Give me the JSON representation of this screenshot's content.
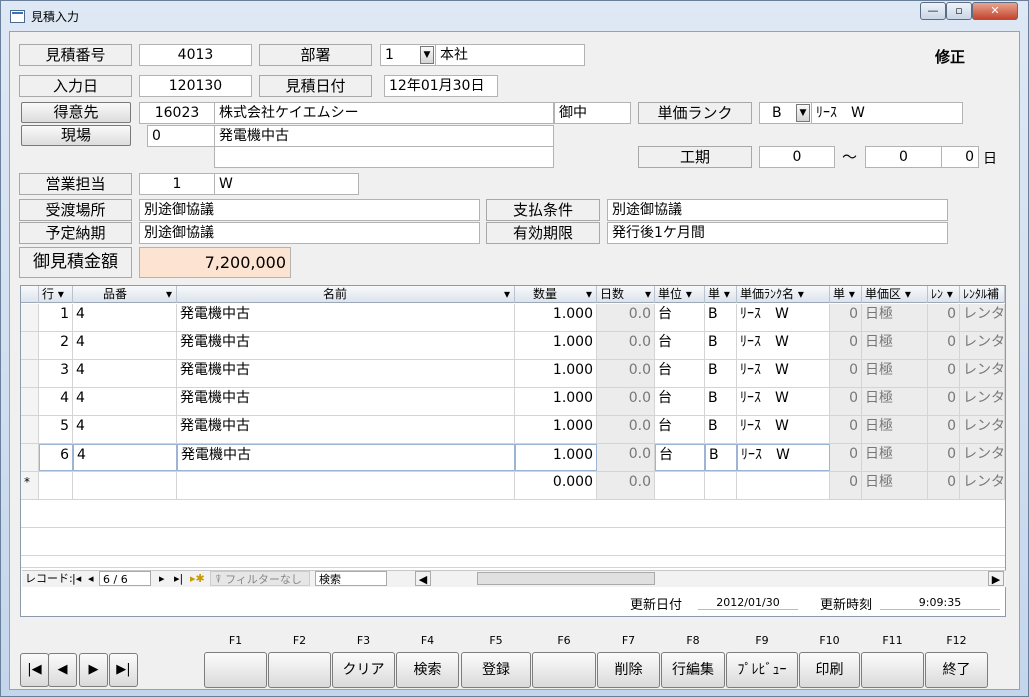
{
  "window": {
    "title": "見積入力",
    "min": "—",
    "max": "▫",
    "close": "✕"
  },
  "header": {
    "estimate_no_label": "見積番号",
    "estimate_no": "4013",
    "dept_label": "部署",
    "dept_code": "1",
    "dept_name": "本社",
    "mode": "修正",
    "input_date_label": "入力日",
    "input_date": "120130",
    "estimate_date_label": "見積日付",
    "estimate_date": "12年01月30日",
    "customer_btn": "得意先",
    "customer_code": "16023",
    "customer_name": "株式会社ケイエムシー",
    "honorific": "御中",
    "site_btn": "現場",
    "site_code": "0",
    "site_name": "発電機中古",
    "site_extra": "",
    "price_rank_label": "単価ランク",
    "price_rank": "B",
    "price_rank_name": "ﾘｰｽ　W",
    "period_label": "工期",
    "period_from": "0",
    "period_sep": "～",
    "period_to": "0",
    "period_days": "0",
    "period_unit": "日",
    "sales_label": "営業担当",
    "sales_code": "1",
    "sales_name": "W",
    "delivery_place_label": "受渡場所",
    "delivery_place": "別途御協議",
    "payment_label": "支払条件",
    "payment": "別途御協議",
    "due_label": "予定納期",
    "due": "別途御協議",
    "valid_label": "有効期限",
    "valid": "発行後1ケ月間",
    "amount_label": "御見積金額",
    "amount": "7,200,000"
  },
  "grid": {
    "columns": [
      "行",
      "品番",
      "名前",
      "数量",
      "日数",
      "単位",
      "単",
      "単価ﾗﾝｸ名",
      "単",
      "単価区",
      "ﾚﾝ",
      "ﾚﾝﾀﾙ補"
    ],
    "rows": [
      {
        "line": "1",
        "code": "4",
        "name": "発電機中古",
        "qty": "1.000",
        "days": "0.0",
        "unit": "台",
        "rank": "B",
        "rank_name": "ﾘｰｽ　W",
        "u": "0",
        "price_div": "日極",
        "r": "0",
        "rental": "レンタ"
      },
      {
        "line": "2",
        "code": "4",
        "name": "発電機中古",
        "qty": "1.000",
        "days": "0.0",
        "unit": "台",
        "rank": "B",
        "rank_name": "ﾘｰｽ　W",
        "u": "0",
        "price_div": "日極",
        "r": "0",
        "rental": "レンタ"
      },
      {
        "line": "3",
        "code": "4",
        "name": "発電機中古",
        "qty": "1.000",
        "days": "0.0",
        "unit": "台",
        "rank": "B",
        "rank_name": "ﾘｰｽ　W",
        "u": "0",
        "price_div": "日極",
        "r": "0",
        "rental": "レンタ"
      },
      {
        "line": "4",
        "code": "4",
        "name": "発電機中古",
        "qty": "1.000",
        "days": "0.0",
        "unit": "台",
        "rank": "B",
        "rank_name": "ﾘｰｽ　W",
        "u": "0",
        "price_div": "日極",
        "r": "0",
        "rental": "レンタ"
      },
      {
        "line": "5",
        "code": "4",
        "name": "発電機中古",
        "qty": "1.000",
        "days": "0.0",
        "unit": "台",
        "rank": "B",
        "rank_name": "ﾘｰｽ　W",
        "u": "0",
        "price_div": "日極",
        "r": "0",
        "rental": "レンタ"
      },
      {
        "line": "6",
        "code": "4",
        "name": "発電機中古",
        "qty": "1.000",
        "days": "0.0",
        "unit": "台",
        "rank": "B",
        "rank_name": "ﾘｰｽ　W",
        "u": "0",
        "price_div": "日極",
        "r": "0",
        "rental": "レンタ"
      }
    ],
    "new_row": {
      "marker": "*",
      "qty": "0.000",
      "days": "0.0",
      "u": "0",
      "price_div": "日極",
      "r": "0",
      "rental": "レンタ"
    },
    "nav": {
      "record_label": "レコード:",
      "position": "6 / 6",
      "filter": "フィルターなし",
      "search": "検索"
    }
  },
  "footer": {
    "update_date_label": "更新日付",
    "update_date": "2012/01/30",
    "update_time_label": "更新時刻",
    "update_time": "9:09:35"
  },
  "fkeys": [
    {
      "key": "F1",
      "label": ""
    },
    {
      "key": "F2",
      "label": ""
    },
    {
      "key": "F3",
      "label": "クリア"
    },
    {
      "key": "F4",
      "label": "検索"
    },
    {
      "key": "F5",
      "label": "登録"
    },
    {
      "key": "F6",
      "label": ""
    },
    {
      "key": "F7",
      "label": "削除"
    },
    {
      "key": "F8",
      "label": "行編集"
    },
    {
      "key": "F9",
      "label": "ﾌﾟﾚﾋﾞｭｰ"
    },
    {
      "key": "F10",
      "label": "印刷"
    },
    {
      "key": "F11",
      "label": ""
    },
    {
      "key": "F12",
      "label": "終了"
    }
  ],
  "nav_buttons": {
    "first": "|◀",
    "prev": "◀",
    "next": "▶",
    "last": "▶|"
  }
}
